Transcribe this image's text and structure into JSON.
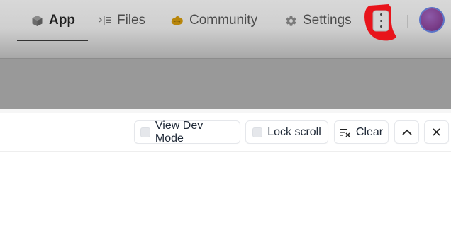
{
  "nav": {
    "tabs": [
      {
        "label": "App",
        "icon": "cube-icon",
        "active": true
      },
      {
        "label": "Files",
        "icon": "files-icon",
        "active": false
      },
      {
        "label": "Community",
        "icon": "community-icon",
        "active": false
      },
      {
        "label": "Settings",
        "icon": "gear-icon",
        "active": false
      }
    ],
    "more_icon": "kebab-menu-icon",
    "highlight_color": "#e8141b",
    "avatar_color": "#7c3f8a"
  },
  "toolbar": {
    "view_dev_mode": "View Dev Mode",
    "lock_scroll": "Lock scroll",
    "clear": "Clear",
    "collapse_icon": "chevron-up-icon",
    "close_icon": "close-icon"
  }
}
